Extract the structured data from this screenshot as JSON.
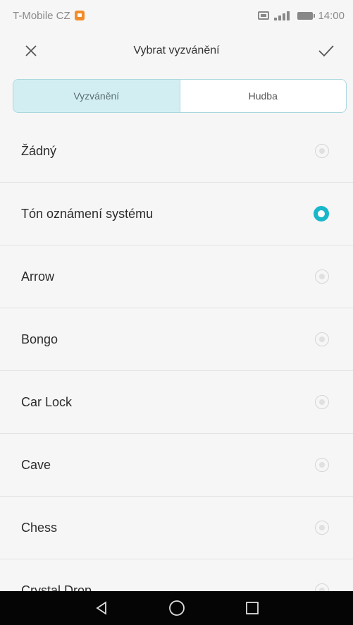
{
  "status_bar": {
    "carrier": "T-Mobile CZ",
    "time": "14:00"
  },
  "header": {
    "title": "Vybrat vyzvánění",
    "close_icon": "close-icon",
    "confirm_icon": "checkmark-icon"
  },
  "tabs": [
    {
      "label": "Vyzvánění",
      "active": true
    },
    {
      "label": "Hudba",
      "active": false
    }
  ],
  "ringtones": [
    {
      "label": "Žádný",
      "selected": false
    },
    {
      "label": "Tón oznámení systému",
      "selected": true
    },
    {
      "label": "Arrow",
      "selected": false
    },
    {
      "label": "Bongo",
      "selected": false
    },
    {
      "label": "Car Lock",
      "selected": false
    },
    {
      "label": "Cave",
      "selected": false
    },
    {
      "label": "Chess",
      "selected": false
    },
    {
      "label": "Crystal Drop",
      "selected": false
    }
  ],
  "navbar": {
    "back_icon": "back-triangle-icon",
    "home_icon": "home-circle-icon",
    "recents_icon": "recents-square-icon"
  },
  "colors": {
    "accent": "#19b7c9",
    "tab_active_bg": "#d3eef2",
    "tab_border": "#a9d8df",
    "notification": "#f28c28"
  }
}
